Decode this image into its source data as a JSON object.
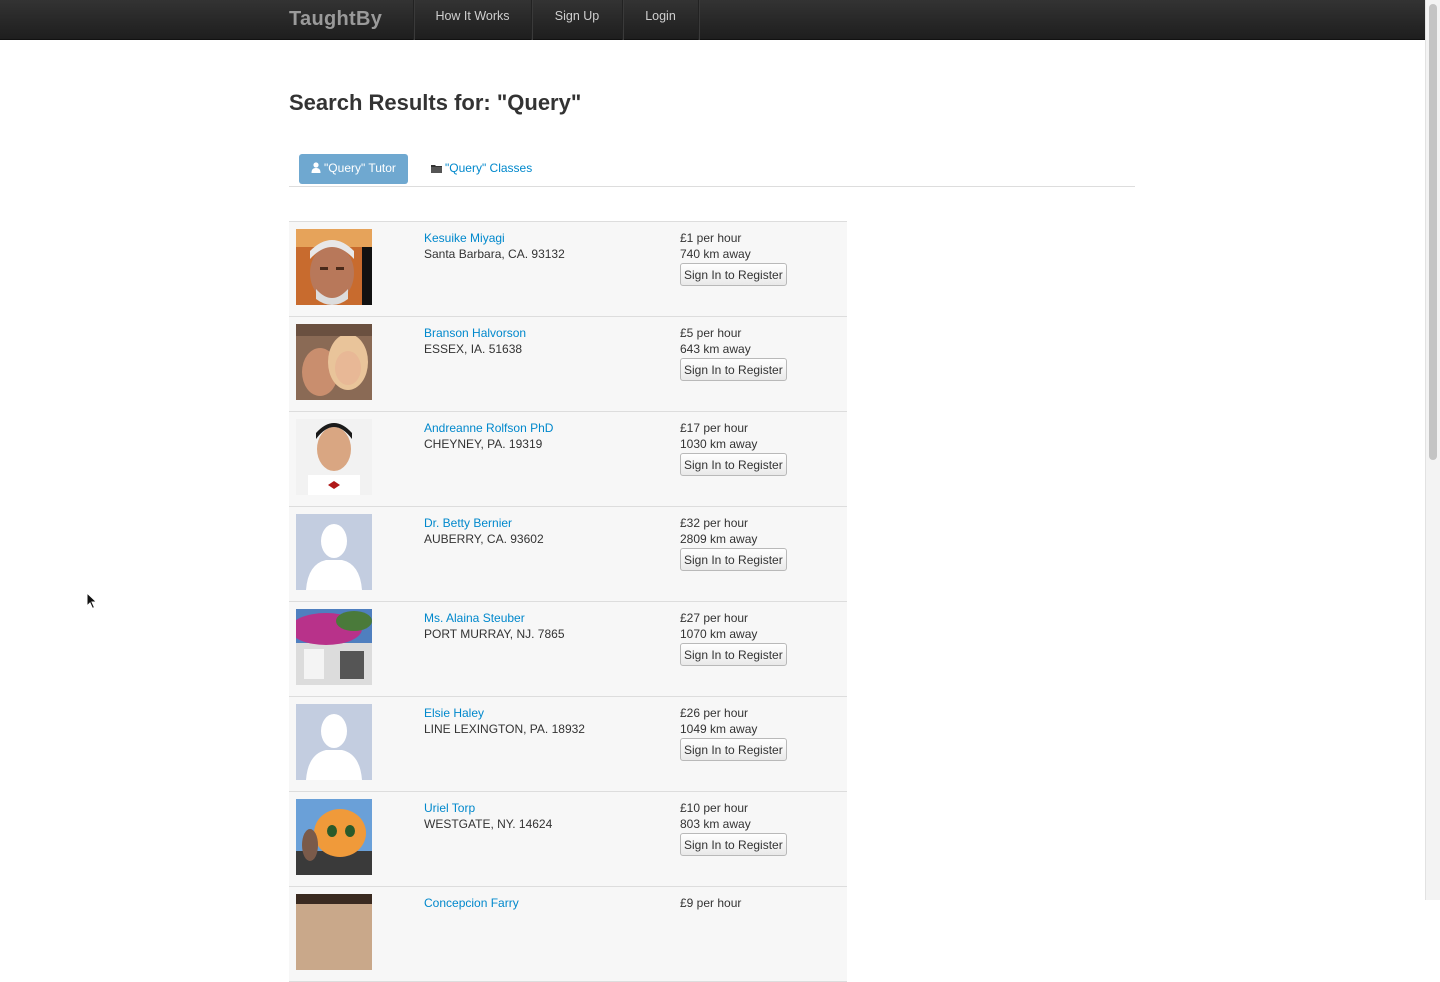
{
  "navbar": {
    "brand": "TaughtBy",
    "items": [
      {
        "label": "How It Works"
      },
      {
        "label": "Sign Up"
      },
      {
        "label": "Login"
      }
    ]
  },
  "page": {
    "title": "Search Results for: \"Query\""
  },
  "tabs": [
    {
      "label": "\"Query\" Tutor",
      "icon": "user-icon",
      "active": true
    },
    {
      "label": "\"Query\" Classes",
      "icon": "folder-icon",
      "active": false
    }
  ],
  "results": [
    {
      "name": "Kesuike Miyagi",
      "location": "Santa Barbara, CA. 93132",
      "price": "£1 per hour",
      "distance": "740 km away",
      "button": "Sign In to Register",
      "avatar": "photo-elderly-man"
    },
    {
      "name": "Branson Halvorson",
      "location": "ESSEX, IA. 51638",
      "price": "£5 per hour",
      "distance": "643 km away",
      "button": "Sign In to Register",
      "avatar": "photo-couple"
    },
    {
      "name": "Andreanne Rolfson PhD",
      "location": "CHEYNEY, PA. 19319",
      "price": "£17 per hour",
      "distance": "1030 km away",
      "button": "Sign In to Register",
      "avatar": "photo-young-man"
    },
    {
      "name": "Dr. Betty Bernier",
      "location": "AUBERRY, CA. 93602",
      "price": "£32 per hour",
      "distance": "2809 km away",
      "button": "Sign In to Register",
      "avatar": "default-silhouette"
    },
    {
      "name": "Ms. Alaina Steuber",
      "location": "PORT MURRAY, NJ. 7865",
      "price": "£27 per hour",
      "distance": "1070 km away",
      "button": "Sign In to Register",
      "avatar": "photo-flowers-house"
    },
    {
      "name": "Elsie Haley",
      "location": "LINE LEXINGTON, PA. 18932",
      "price": "£26 per hour",
      "distance": "1049 km away",
      "button": "Sign In to Register",
      "avatar": "default-silhouette"
    },
    {
      "name": "Uriel Torp",
      "location": "WESTGATE, NY. 14624",
      "price": "£10 per hour",
      "distance": "803 km away",
      "button": "Sign In to Register",
      "avatar": "photo-cartoon-cat"
    },
    {
      "name": "Concepcion Farry",
      "location": "",
      "price": "£9 per hour",
      "distance": "",
      "button": "",
      "avatar": "photo-partial"
    }
  ],
  "colors": {
    "navbar": "#222222",
    "link": "#0088cc",
    "active_tab": "#6fa8d0",
    "row_bg": "#f7f7f7"
  }
}
